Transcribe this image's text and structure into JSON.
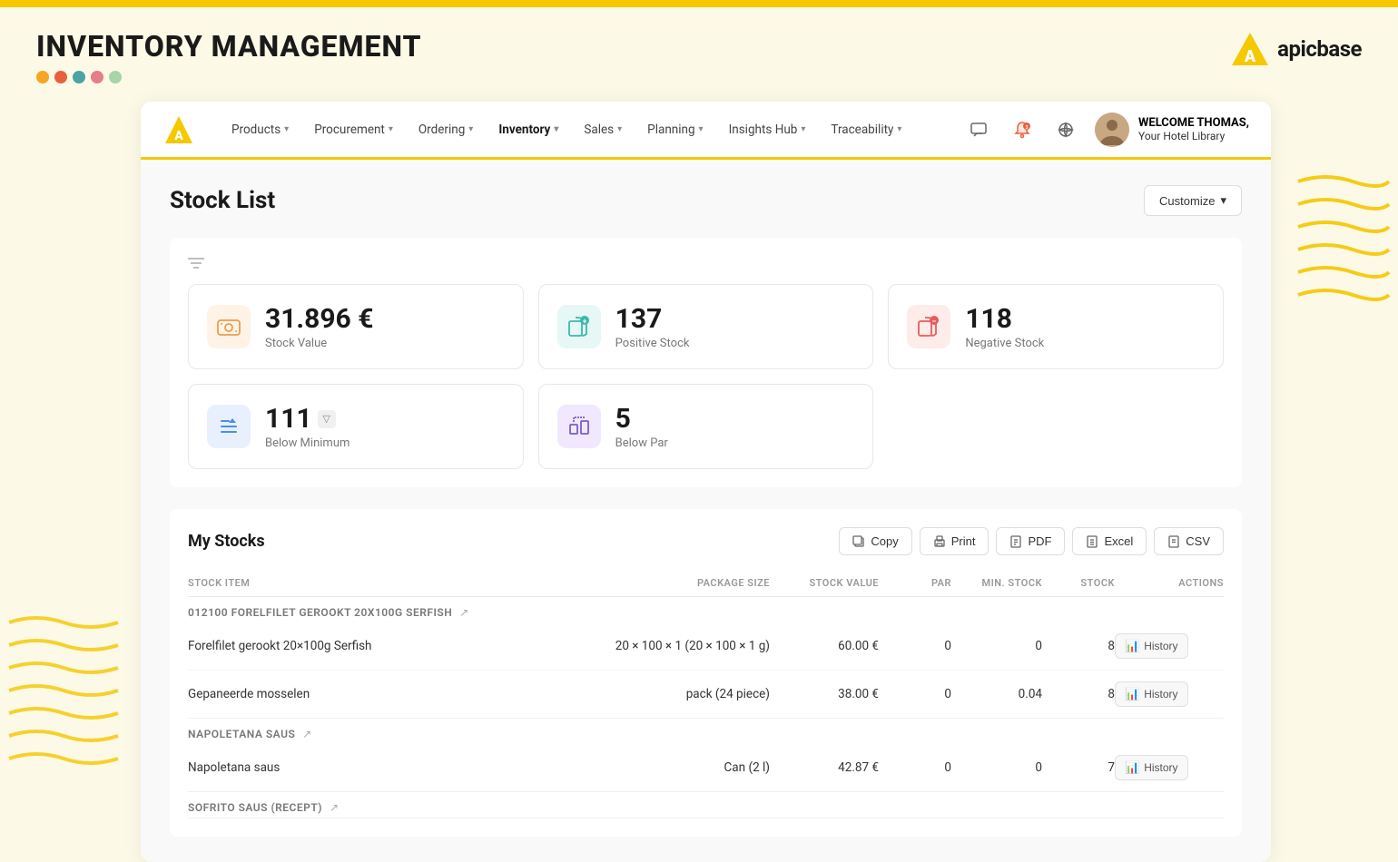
{
  "topBar": {},
  "header": {
    "appTitle": "INVENTORY MANAGEMENT",
    "dots": [
      {
        "color": "#f5a623"
      },
      {
        "color": "#e8613c"
      },
      {
        "color": "#4ba3a3"
      },
      {
        "color": "#e87c8a"
      },
      {
        "color": "#a8d4a8"
      }
    ],
    "logo": {
      "text": "apicbase"
    }
  },
  "navbar": {
    "items": [
      {
        "label": "Products",
        "active": false,
        "hasChevron": true
      },
      {
        "label": "Procurement",
        "active": false,
        "hasChevron": true
      },
      {
        "label": "Ordering",
        "active": false,
        "hasChevron": true
      },
      {
        "label": "Inventory",
        "active": true,
        "hasChevron": true
      },
      {
        "label": "Sales",
        "active": false,
        "hasChevron": true
      },
      {
        "label": "Planning",
        "active": false,
        "hasChevron": true
      },
      {
        "label": "Insights Hub",
        "active": false,
        "hasChevron": true
      },
      {
        "label": "Traceability",
        "active": false,
        "hasChevron": true
      }
    ],
    "user": {
      "welcomeText": "WELCOME THOMAS,",
      "hotelText": "Your Hotel Library"
    }
  },
  "page": {
    "title": "Stock List",
    "customizeLabel": "Customize"
  },
  "stats": [
    {
      "value": "31.896 €",
      "label": "Stock Value",
      "iconType": "orange"
    },
    {
      "value": "137",
      "label": "Positive Stock",
      "iconType": "teal"
    },
    {
      "value": "118",
      "label": "Negative Stock",
      "iconType": "red"
    },
    {
      "value": "111",
      "label": "Below Minimum",
      "iconType": "blue",
      "hasFilter": true
    },
    {
      "value": "5",
      "label": "Below Par",
      "iconType": "purple"
    }
  ],
  "myStocks": {
    "title": "My Stocks",
    "actionButtons": [
      "Copy",
      "Print",
      "PDF",
      "Excel",
      "CSV"
    ],
    "columns": [
      "STOCK ITEM",
      "PACKAGE SIZE",
      "STOCK VALUE",
      "PAR",
      "MIN. STOCK",
      "STOCK",
      "ACTIONS"
    ],
    "groups": [
      {
        "name": "012100 FORELFILET GEROOKT 20X100G SERFISH",
        "hasLink": true,
        "rows": [
          {
            "item": "Forelfilet gerookt 20×100g Serfish",
            "packageSize": "20 × 100 × 1 (20 × 100 × 1 g)",
            "stockValue": "60.00 €",
            "par": "0",
            "minStock": "0",
            "stock": "8",
            "actionLabel": "History"
          },
          {
            "item": "Gepaneerde mosselen",
            "packageSize": "pack (24 piece)",
            "stockValue": "38.00 €",
            "par": "0",
            "minStock": "0.04",
            "stock": "8",
            "actionLabel": "History"
          }
        ]
      },
      {
        "name": "NAPOLETANA SAUS",
        "hasLink": true,
        "rows": [
          {
            "item": "Napoletana saus",
            "packageSize": "Can (2 l)",
            "stockValue": "42.87 €",
            "par": "0",
            "minStock": "0",
            "stock": "7",
            "actionLabel": "History"
          }
        ]
      },
      {
        "name": "SOFRITO SAUS (RECEPT)",
        "hasLink": true,
        "rows": []
      }
    ]
  }
}
